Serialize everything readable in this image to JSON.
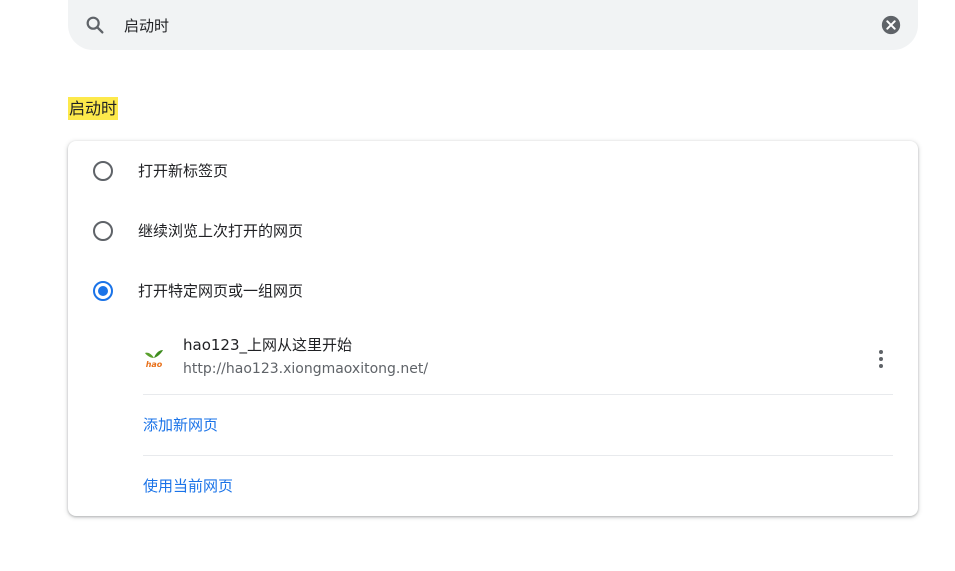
{
  "search": {
    "value": "启动时",
    "icon": "search-icon",
    "clear_icon": "clear-circle-icon"
  },
  "section": {
    "title": "启动时",
    "highlight_color": "#fde94b"
  },
  "startup_options": [
    {
      "label": "打开新标签页",
      "checked": false
    },
    {
      "label": "继续浏览上次打开的网页",
      "checked": false
    },
    {
      "label": "打开特定网页或一组网页",
      "checked": true
    }
  ],
  "startup_pages": [
    {
      "title": "hao123_上网从这里开始",
      "url": "http://hao123.xiongmaoxitong.net/",
      "favicon": "hao123-favicon",
      "favicon_text": "hao"
    }
  ],
  "actions": {
    "add_page": "添加新网页",
    "use_current": "使用当前网页"
  },
  "colors": {
    "accent": "#1a73e8",
    "text": "#202124",
    "secondary_text": "#5f6368"
  }
}
